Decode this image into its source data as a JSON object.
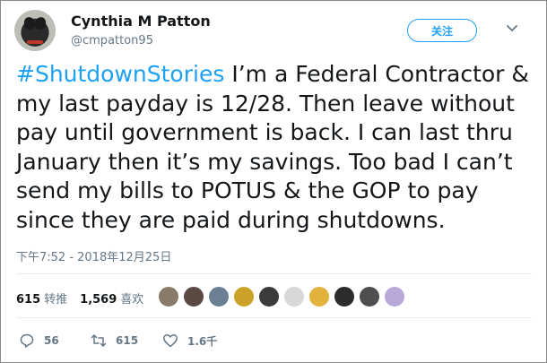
{
  "author": {
    "name": "Cynthia M Patton",
    "handle": "@cmpatton95"
  },
  "follow_label": "关注",
  "tweet": {
    "hashtag": "#ShutdownStories",
    "body": " I’m a Federal Contractor & my last payday is 12/28. Then leave without pay until government is back. I can last thru January then it’s my savings. Too bad I can’t send my bills to POTUS & the GOP to pay since they are paid during shutdowns."
  },
  "timestamp": "下午7:52 - 2018年12月25日",
  "stats": {
    "retweets_num": "615",
    "retweets_label": "转推",
    "likes_num": "1,569",
    "likes_label": "喜欢"
  },
  "liker_colors": [
    "#8a7a6a",
    "#5a4a42",
    "#6b7f95",
    "#c9a227",
    "#3b3b3b",
    "#d8d8d8",
    "#e2b33c",
    "#2c2c2c",
    "#4f4f4f",
    "#b8a8d8"
  ],
  "actions": {
    "reply_count": "56",
    "retweet_count": "615",
    "like_count": "1.6千"
  },
  "colors": {
    "accent": "#1da1f2",
    "muted": "#657786",
    "text": "#14171a"
  }
}
